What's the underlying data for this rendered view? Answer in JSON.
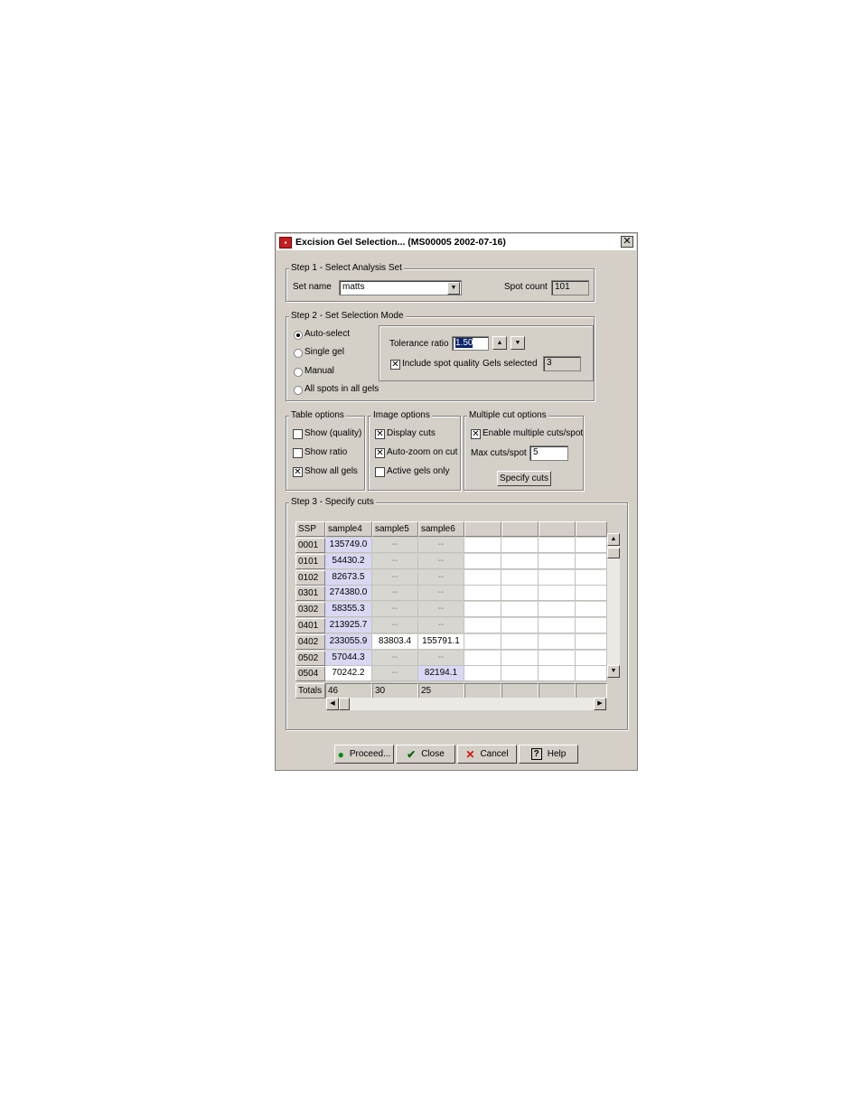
{
  "window": {
    "title": "Excision Gel Selection... (MS00005 2002-07-16)"
  },
  "step1": {
    "legend": "Step 1 - Select Analysis Set",
    "set_name_label": "Set name",
    "set_name_value": "matts",
    "spot_count_label": "Spot count",
    "spot_count_value": "101"
  },
  "step2": {
    "legend": "Step 2 - Set Selection Mode",
    "modes": [
      {
        "label": "Auto-select",
        "selected": true
      },
      {
        "label": "Single gel",
        "selected": false
      },
      {
        "label": "Manual",
        "selected": false
      },
      {
        "label": "All spots in all gels",
        "selected": false
      }
    ],
    "tolerance_label": "Tolerance ratio",
    "tolerance_value": "1.50",
    "include_quality_label": "Include spot quality",
    "include_quality_checked": true,
    "gels_selected_label": "Gels selected",
    "gels_selected_value": "3"
  },
  "table_options": {
    "legend": "Table options",
    "items": [
      {
        "label": "Show (quality)",
        "checked": false
      },
      {
        "label": "Show ratio",
        "checked": false
      },
      {
        "label": "Show all gels",
        "checked": true
      }
    ]
  },
  "image_options": {
    "legend": "Image options",
    "items": [
      {
        "label": "Display cuts",
        "checked": true
      },
      {
        "label": "Auto-zoom on cut",
        "checked": true
      },
      {
        "label": "Active gels only",
        "checked": false
      }
    ]
  },
  "multi_cut": {
    "legend": "Multiple cut options",
    "enable_label": "Enable multiple cuts/spot",
    "enable_checked": true,
    "max_label": "Max cuts/spot",
    "max_value": "5",
    "specify_button": "Specify cuts"
  },
  "step3": {
    "legend": "Step 3 - Specify cuts",
    "columns": [
      "SSP",
      "sample4",
      "sample5",
      "sample6",
      "",
      "",
      "",
      ""
    ],
    "rows": [
      {
        "ssp": "0001",
        "cells": [
          {
            "v": "135749.0",
            "s": "sel"
          },
          {
            "v": "--",
            "s": "dis"
          },
          {
            "v": "--",
            "s": "dis"
          }
        ]
      },
      {
        "ssp": "0101",
        "cells": [
          {
            "v": "54430.2",
            "s": "sel"
          },
          {
            "v": "--",
            "s": "dis"
          },
          {
            "v": "--",
            "s": "dis"
          }
        ]
      },
      {
        "ssp": "0102",
        "cells": [
          {
            "v": "82673.5",
            "s": "sel"
          },
          {
            "v": "--",
            "s": "dis"
          },
          {
            "v": "--",
            "s": "dis"
          }
        ]
      },
      {
        "ssp": "0301",
        "cells": [
          {
            "v": "274380.0",
            "s": "sel"
          },
          {
            "v": "--",
            "s": "dis"
          },
          {
            "v": "--",
            "s": "dis"
          }
        ]
      },
      {
        "ssp": "0302",
        "cells": [
          {
            "v": "58355.3",
            "s": "sel"
          },
          {
            "v": "--",
            "s": "dis"
          },
          {
            "v": "--",
            "s": "dis"
          }
        ]
      },
      {
        "ssp": "0401",
        "cells": [
          {
            "v": "213925.7",
            "s": "sel"
          },
          {
            "v": "--",
            "s": "dis"
          },
          {
            "v": "--",
            "s": "dis"
          }
        ]
      },
      {
        "ssp": "0402",
        "cells": [
          {
            "v": "233055.9",
            "s": "sel"
          },
          {
            "v": "83803.4",
            "s": "wht"
          },
          {
            "v": "155791.1",
            "s": "wht"
          }
        ]
      },
      {
        "ssp": "0502",
        "cells": [
          {
            "v": "57044.3",
            "s": "sel"
          },
          {
            "v": "--",
            "s": "dis"
          },
          {
            "v": "--",
            "s": "dis"
          }
        ]
      },
      {
        "ssp": "0504",
        "cells": [
          {
            "v": "70242.2",
            "s": "wht"
          },
          {
            "v": "--",
            "s": "dis"
          },
          {
            "v": "82194.1",
            "s": "sel"
          }
        ]
      }
    ],
    "totals_label": "Totals",
    "totals": [
      "46",
      "30",
      "25"
    ]
  },
  "buttons": {
    "proceed": "Proceed...",
    "close": "Close",
    "cancel": "Cancel",
    "help": "Help"
  }
}
